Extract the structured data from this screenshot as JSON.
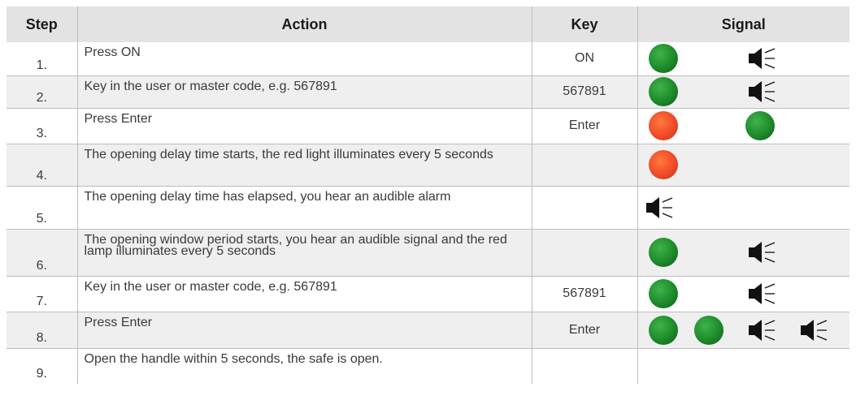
{
  "headers": {
    "step": "Step",
    "action": "Action",
    "key": "Key",
    "signal": "Signal"
  },
  "rows": [
    {
      "step": "1.",
      "action": "Press ON",
      "key": "ON",
      "signals": [
        "green-light",
        "speaker"
      ]
    },
    {
      "step": "2.",
      "action": "Key in the user or master code, e.g. 567891",
      "key": "567891",
      "signals": [
        "green-light",
        "speaker"
      ]
    },
    {
      "step": "3.",
      "action": "Press Enter",
      "key": "Enter",
      "signals": [
        "red-light",
        "green-light"
      ]
    },
    {
      "step": "4.",
      "action": "The opening delay time starts, the red light illuminates every 5 seconds",
      "key": "",
      "signals": [
        "red-light"
      ]
    },
    {
      "step": "5.",
      "action": "The opening delay time has elapsed, you hear an audible alarm",
      "key": "",
      "signals": [
        "speaker"
      ]
    },
    {
      "step": "6.",
      "action": "The opening window period starts, you hear an audible signal and the red lamp illuminates every 5 seconds",
      "key": "",
      "signals": [
        "green-light",
        "speaker"
      ]
    },
    {
      "step": "7.",
      "action": "Key in the user or master code, e.g. 567891",
      "key": "567891",
      "signals": [
        "green-light",
        "speaker"
      ]
    },
    {
      "step": "8.",
      "action": "Press Enter",
      "key": "Enter",
      "signals": [
        "green-light",
        "green-light",
        "speaker",
        "speaker"
      ]
    },
    {
      "step": "9.",
      "action": "Open the handle within 5 seconds, the safe is open.",
      "key": "",
      "signals": []
    }
  ],
  "colors": {
    "header_bg": "#e3e3e3",
    "alt_row_bg": "#efefef",
    "green_light": "#1d8a2a",
    "red_light": "#f04a2a",
    "border": "#bdbdbd"
  }
}
